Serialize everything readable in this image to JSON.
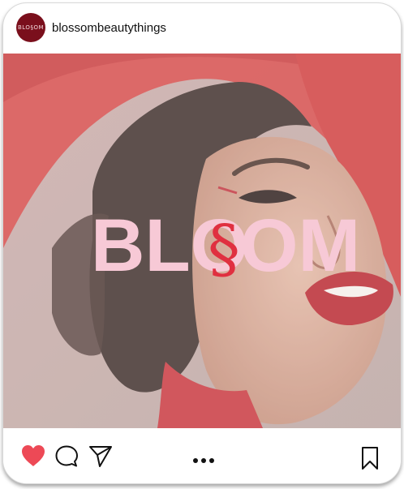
{
  "post": {
    "username": "blossombeautythings",
    "avatar_text": "BLO§OM",
    "brand": {
      "part1": "BLO",
      "symbol": "§",
      "part2": "OM"
    }
  },
  "icons": {
    "like": "heart-icon",
    "comment": "comment-bubble-icon",
    "share": "paper-plane-icon",
    "more": "more-dots-icon",
    "save": "bookmark-icon"
  },
  "colors": {
    "like": "#ed4956",
    "brand_text": "#f7c9d6",
    "brand_symbol": "#e03040",
    "hat": "#d6403f",
    "avatar": "#7a0f1c"
  }
}
